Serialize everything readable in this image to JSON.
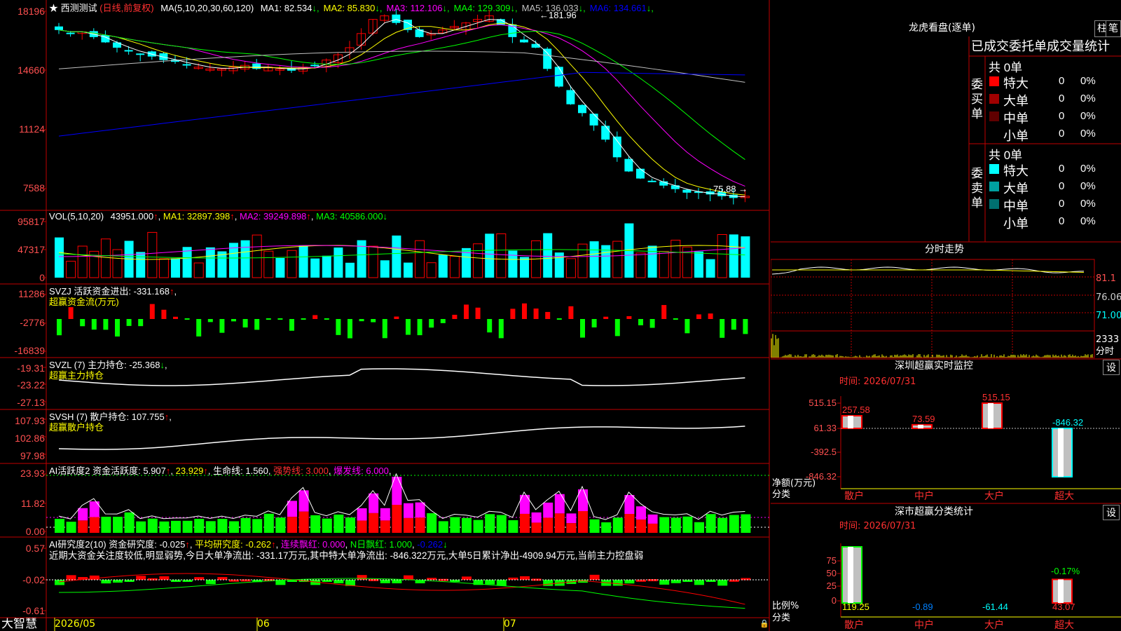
{
  "main": {
    "title_star": "★",
    "title": "西测测试",
    "period": "(日线,前复权)",
    "ma_label": "MA(5,10,20,30,60,120)",
    "ma": [
      {
        "label": "MA1:",
        "value": "82.534",
        "arrow": "↓",
        "color": "#ffffff"
      },
      {
        "label": "MA2:",
        "value": "85.830",
        "arrow": "↓",
        "color": "#ffff00"
      },
      {
        "label": "MA3:",
        "value": "112.106",
        "arrow": "↓",
        "color": "#ff00ff"
      },
      {
        "label": "MA4:",
        "value": "129.309",
        "arrow": "↓",
        "color": "#00ff00"
      },
      {
        "label": "MA5:",
        "value": "136.033",
        "arrow": "↓",
        "color": "#c0c0c0"
      },
      {
        "label": "MA6:",
        "value": "134.661",
        "arrow": "↓",
        "color": "#0000ff"
      }
    ],
    "y_ticks": [
      "18196",
      "14660",
      "11124",
      "7588"
    ],
    "high_label": "181.96",
    "low_label": "75.88"
  },
  "vol": {
    "label": "VOL(5,10,20)",
    "value": "43951.000",
    "arrow": "↑",
    "ma1": "MA1: 32897.398",
    "ma2": "MA2: 39249.898",
    "ma3": "MA3: 40586.000",
    "y_ticks": [
      "95817",
      "47317",
      "0"
    ]
  },
  "svzj": {
    "label": "SVZJ  活跃资金进出: -331.168",
    "arrow": "↑",
    "sub": "超赢资金流(万元)",
    "y_ticks": [
      "11286",
      "-2776",
      "-16839"
    ]
  },
  "svzl": {
    "label": "SVZL (7) 主力持仓: -25.368",
    "arrow": "↓",
    "sub": "超赢主力持仓",
    "y_ticks": [
      "-19.31",
      "-23.22",
      "-27.13"
    ]
  },
  "svsh": {
    "label": "SVSH (7) 散户持仓: 107.755",
    "arrow": "↑",
    "sub": "超赢散户持仓",
    "y_ticks": [
      "107.93",
      "102.86",
      "97.98"
    ]
  },
  "ai1": {
    "label": "AI活跃度2 资金活跃度: 5.907",
    "v2": "23.929",
    "v3": "生命线: 1.560",
    "v4": "强势线: 3.000",
    "v5": "爆发线: 6.000",
    "y_ticks": [
      "23.93",
      "11.82",
      "0.00"
    ]
  },
  "ai2": {
    "label": "AI研究度2(10) 资金研究度: -0.025",
    "v2": "平均研究度: -0.262",
    "v3": "连续飘红: 0.000",
    "v4": "N日飘红: 1.000",
    "v5": "-0.262",
    "text": "近期大资金关注度较低,明显弱势,今日大单净流出: -331.17万元,其中特大单净流出: -846.322万元,大单5日累计净出-4909.94万元,当前主力控盘弱",
    "y_ticks": [
      "0.57",
      "-0.02",
      "-0.61"
    ]
  },
  "xaxis": {
    "brand": "大智慧",
    "labels": [
      "2026/05",
      "06",
      "07"
    ]
  },
  "right": {
    "lhb_title": "龙虎看盘(逐单)",
    "btn1": "柱",
    "btn2": "笔",
    "stat_title": "已成交委托单成交量统计",
    "buy": {
      "side": "委买单",
      "total": "共 0单",
      "rows": [
        {
          "name": "特大",
          "n": "0",
          "p": "0%",
          "color": "#ff0000"
        },
        {
          "name": "大单",
          "n": "0",
          "p": "0%",
          "color": "#a00000"
        },
        {
          "name": "中单",
          "n": "0",
          "p": "0%",
          "color": "#600000"
        },
        {
          "name": "小单",
          "n": "0",
          "p": "0%",
          "color": "#000000"
        }
      ]
    },
    "sell": {
      "side": "委卖单",
      "total": "共 0单",
      "rows": [
        {
          "name": "特大",
          "n": "0",
          "p": "0%",
          "color": "#00ffff"
        },
        {
          "name": "大单",
          "n": "0",
          "p": "0%",
          "color": "#00a0a0"
        },
        {
          "name": "中单",
          "n": "0",
          "p": "0%",
          "color": "#007070"
        },
        {
          "name": "小单",
          "n": "0",
          "p": "0%",
          "color": "#000000"
        }
      ]
    },
    "fs_title": "分时走势",
    "fs_ticks": [
      "81.1",
      "76.06",
      "71.00",
      "2333",
      "分时"
    ],
    "sz_title": "深圳超赢实时监控",
    "sz_btn": "设",
    "sz_time": "时间: 2026/07/31",
    "sz_ticks": [
      "515.15",
      "61.33",
      "-392.5",
      "-846.32"
    ],
    "sz_axis_label": "净额(万元)",
    "sz_axis_label2": "分类",
    "sz_cats": [
      "散户",
      "中户",
      "大户",
      "超大"
    ],
    "sz_values": [
      "257.58",
      "73.59",
      "515.15",
      "-846.32"
    ],
    "ss_title": "深市超赢分类统计",
    "ss_btn": "设",
    "ss_time": "时间: 2026/07/31",
    "ss_ticks": [
      "75",
      "50",
      "25",
      "0"
    ],
    "ss_axis_label": "比例%",
    "ss_axis_label2": "分类",
    "ss_cats": [
      "散户",
      "中户",
      "大户",
      "超大"
    ],
    "ss_values": [
      "119.25",
      "-0.89",
      "-61.44",
      "43.07"
    ],
    "ss_top_label": "-0.17%"
  },
  "colors": {
    "up": "#ff0000",
    "down": "#00ffff",
    "grid": "#c00000",
    "axis": "#ff5050"
  }
}
